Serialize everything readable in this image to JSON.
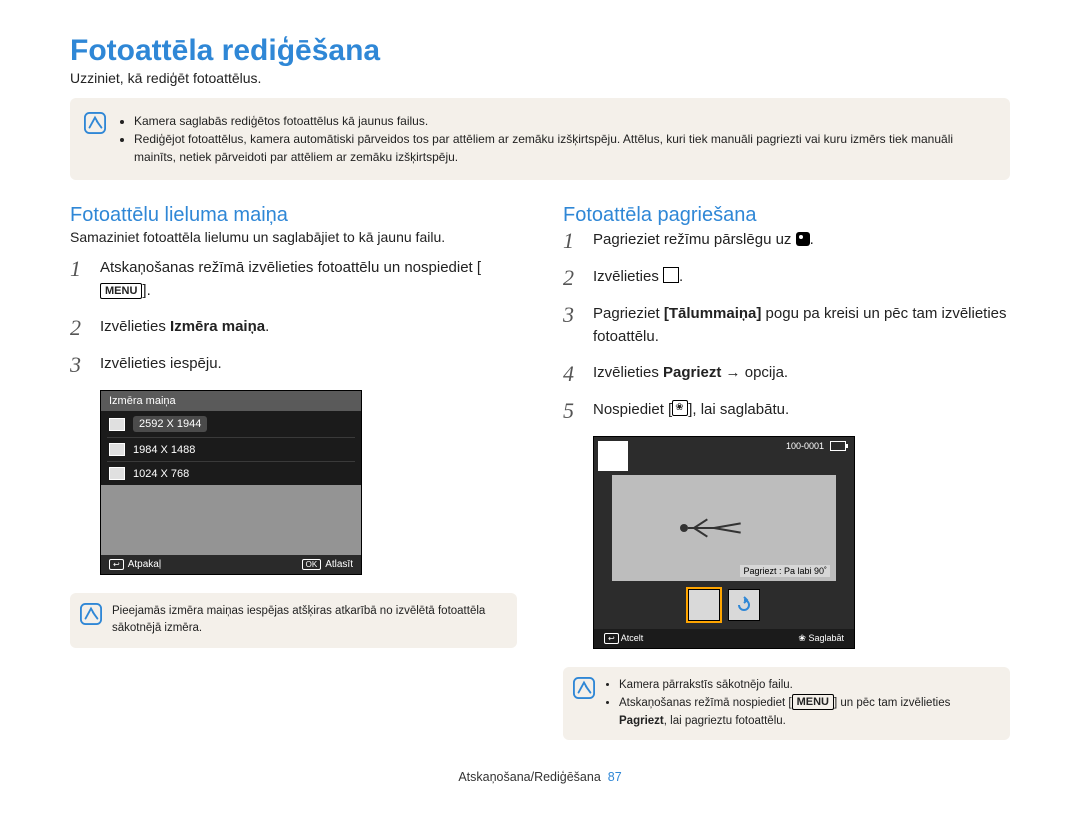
{
  "title": "Fotoattēla rediģēšana",
  "intro": "Uzziniet, kā rediģēt fotoattēlus.",
  "top_note": {
    "items": [
      "Kamera saglabās rediģētos fotoattēlus kā jaunus failus.",
      "Rediģējot fotoattēlus, kamera automātiski pārveidos tos par attēliem ar zemāku izšķirtspēju. Attēlus, kuri tiek manuāli pagriezti vai kuru izmērs tiek manuāli mainīts, netiek pārveidoti par attēliem ar zemāku izšķirtspēju."
    ]
  },
  "left": {
    "heading": "Fotoattēlu lieluma maiņa",
    "intro": "Samaziniet fotoattēla lielumu un saglabājiet to kā jaunu failu.",
    "steps": {
      "s1_pre": "Atskaņošanas režīmā izvēlieties fotoattēlu un nospiediet ",
      "s1_key": "MENU",
      "s1_post": ".",
      "s2_pre": "Izvēlieties ",
      "s2_bold": "Izmēra maiņa",
      "s2_post": ".",
      "s3": "Izvēlieties iespēju."
    },
    "cam": {
      "title": "Izmēra maiņa",
      "opts": [
        "2592 X 1944",
        "1984 X 1488",
        "1024 X 768"
      ],
      "back": "Atpakaļ",
      "ok_glyph": "OK",
      "select": "Atlasīt"
    },
    "note": "Pieejamās izmēra maiņas iespējas atšķiras atkarībā no izvēlētā fotoattēla sākotnējā izmēra."
  },
  "right": {
    "heading": "Fotoattēla pagriešana",
    "steps": {
      "s1_pre": "Pagrieziet režīmu pārslēgu uz ",
      "s1_post": ".",
      "s2_pre": "Izvēlieties ",
      "s2_post": ".",
      "s3_a": "Pagrieziet ",
      "s3_b": "[Tālummaiņa]",
      "s3_c": " pogu pa kreisi un pēc tam izvēlieties fotoattēlu.",
      "s4_a": "Izvēlieties ",
      "s4_b": "Pagriezt",
      "s4_c": " → opcija.",
      "s5_a": "Nospiediet ",
      "s5_b": ", lai saglabātu."
    },
    "cam": {
      "file": "100-0001",
      "caption": "Pagriezt : Pa labi 90˚",
      "cancel": "Atcelt",
      "save": "Saglabāt"
    },
    "note": {
      "items_a": "Kamera pārrakstīs sākotnējo failu.",
      "items_b_pre": "Atskaņošanas režīmā nospiediet ",
      "items_b_key": "MENU",
      "items_b_mid": " un pēc tam izvēlieties ",
      "items_b_bold": "Pagriezt",
      "items_b_post": ", lai pagrieztu fotoattēlu."
    }
  },
  "footer": {
    "chapter": "Atskaņošana/Rediģēšana",
    "page": "87"
  }
}
